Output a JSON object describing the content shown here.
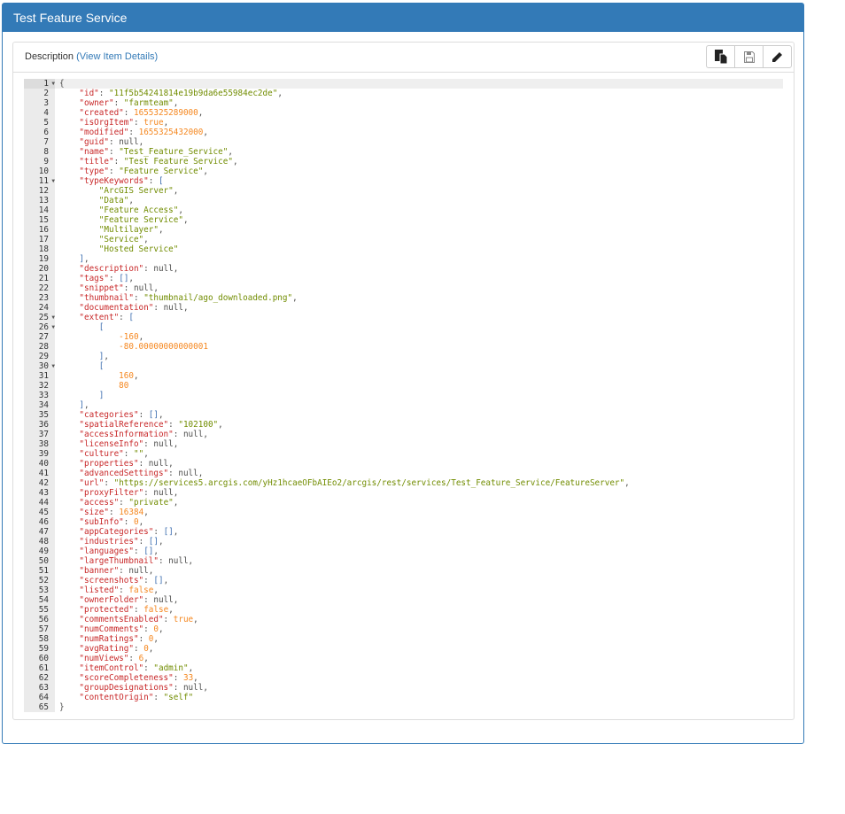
{
  "header": {
    "title": "Test Feature Service"
  },
  "panel": {
    "label": "Description",
    "link": "(View Item Details)"
  },
  "toolbar": {
    "buttons": [
      {
        "icon": "paste-icon"
      },
      {
        "icon": "save-icon"
      },
      {
        "icon": "pencil-icon"
      }
    ]
  },
  "editor": {
    "fold_lines": [
      1,
      11,
      25,
      26,
      30
    ],
    "lines": [
      "{",
      "    \"id\": \"11f5b54241814e19b9da6e55984ec2de\",",
      "    \"owner\": \"farmteam\",",
      "    \"created\": 1655325289000,",
      "    \"isOrgItem\": true,",
      "    \"modified\": 1655325432000,",
      "    \"guid\": null,",
      "    \"name\": \"Test_Feature_Service\",",
      "    \"title\": \"Test Feature Service\",",
      "    \"type\": \"Feature Service\",",
      "    \"typeKeywords\": [",
      "        \"ArcGIS Server\",",
      "        \"Data\",",
      "        \"Feature Access\",",
      "        \"Feature Service\",",
      "        \"Multilayer\",",
      "        \"Service\",",
      "        \"Hosted Service\"",
      "    ],",
      "    \"description\": null,",
      "    \"tags\": [],",
      "    \"snippet\": null,",
      "    \"thumbnail\": \"thumbnail/ago_downloaded.png\",",
      "    \"documentation\": null,",
      "    \"extent\": [",
      "        [",
      "            -160,",
      "            -80.00000000000001",
      "        ],",
      "        [",
      "            160,",
      "            80",
      "        ]",
      "    ],",
      "    \"categories\": [],",
      "    \"spatialReference\": \"102100\",",
      "    \"accessInformation\": null,",
      "    \"licenseInfo\": null,",
      "    \"culture\": \"\",",
      "    \"properties\": null,",
      "    \"advancedSettings\": null,",
      "    \"url\": \"https://services5.arcgis.com/yHz1hcaeOFbAIEo2/arcgis/rest/services/Test_Feature_Service/FeatureServer\",",
      "    \"proxyFilter\": null,",
      "    \"access\": \"private\",",
      "    \"size\": 16384,",
      "    \"subInfo\": 0,",
      "    \"appCategories\": [],",
      "    \"industries\": [],",
      "    \"languages\": [],",
      "    \"largeThumbnail\": null,",
      "    \"banner\": null,",
      "    \"screenshots\": [],",
      "    \"listed\": false,",
      "    \"ownerFolder\": null,",
      "    \"protected\": false,",
      "    \"commentsEnabled\": true,",
      "    \"numComments\": 0,",
      "    \"numRatings\": 0,",
      "    \"avgRating\": 0,",
      "    \"numViews\": 6,",
      "    \"itemControl\": \"admin\",",
      "    \"scoreCompleteness\": 33,",
      "    \"groupDesignations\": null,",
      "    \"contentOrigin\": \"self\"",
      "}"
    ]
  }
}
